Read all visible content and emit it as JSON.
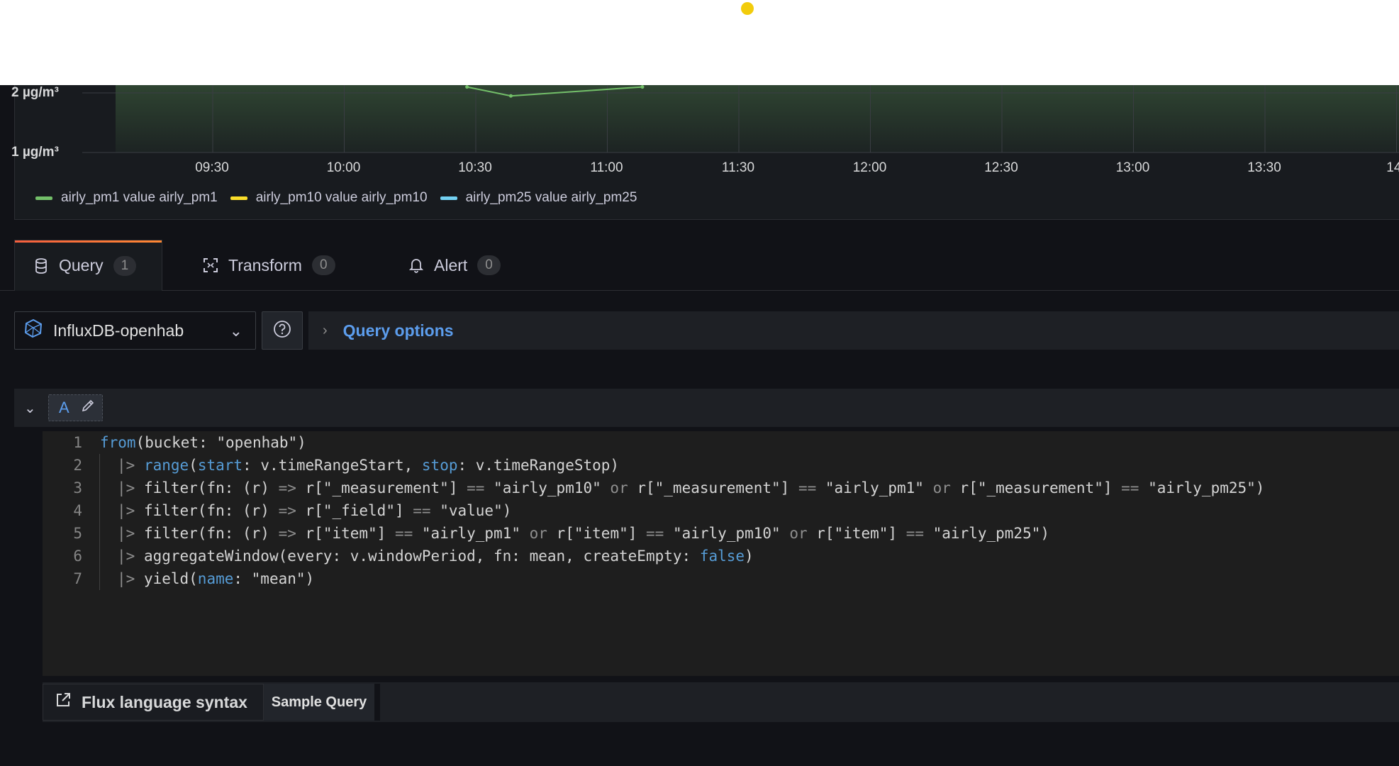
{
  "chart": {
    "y_ticks": [
      "2 µg/m³",
      "1 µg/m³"
    ],
    "x_ticks": [
      "09:30",
      "10:00",
      "10:30",
      "11:00",
      "11:30",
      "12:00",
      "12:30",
      "13:00",
      "13:30",
      "14:"
    ],
    "legend": [
      {
        "label": "airly_pm1 value airly_pm1",
        "color": "#73bf69"
      },
      {
        "label": "airly_pm10 value airly_pm10",
        "color": "#fade2a"
      },
      {
        "label": "airly_pm25 value airly_pm25",
        "color": "#5794f2"
      }
    ]
  },
  "chart_data": {
    "type": "line",
    "title": "",
    "xlabel": "",
    "ylabel": "",
    "categories": [
      "09:30",
      "10:00",
      "10:30",
      "11:00",
      "11:30",
      "12:00",
      "12:30",
      "13:00",
      "13:30",
      "14:"
    ],
    "series": [
      {
        "name": "airly_pm1 value airly_pm1",
        "x": [
          "10:28",
          "10:38",
          "11:08"
        ],
        "values": [
          2.1,
          1.95,
          2.1
        ]
      }
    ],
    "ylim": [
      1,
      2.1
    ],
    "grid": true,
    "legend_position": "bottom"
  },
  "tabs": [
    {
      "label": "Query",
      "count": "1",
      "icon": "database-icon"
    },
    {
      "label": "Transform",
      "count": "0",
      "icon": "transform-icon"
    },
    {
      "label": "Alert",
      "count": "0",
      "icon": "bell-icon"
    }
  ],
  "datasource": {
    "name": "InfluxDB-openhab"
  },
  "query_options_label": "Query options",
  "query": {
    "ref_id": "A"
  },
  "code_lines": [
    {
      "n": "1"
    },
    {
      "n": "2"
    },
    {
      "n": "3"
    },
    {
      "n": "4"
    },
    {
      "n": "5"
    },
    {
      "n": "6"
    },
    {
      "n": "7"
    }
  ],
  "code": {
    "l1": {
      "a": "from",
      "b": "(bucket: \"openhab\")"
    },
    "l2": {
      "pipe": "|> ",
      "a": "range",
      "b": "(",
      "c": "start",
      "d": ": v.timeRangeStart, ",
      "e": "stop",
      "f": ": v.timeRangeStop)"
    },
    "l3": {
      "pipe": "|> ",
      "a": "filter(fn: (r) ",
      "b": "=>",
      "c": " r[\"_measurement\"] ",
      "d": "==",
      "e": " \"airly_pm10\" ",
      "f": "or",
      "g": " r[\"_measurement\"] ",
      "h": "==",
      "i": " \"airly_pm1\" ",
      "j": "or",
      "k": " r[\"_measurement\"] ",
      "l": "==",
      "m": " \"airly_pm25\")"
    },
    "l4": {
      "pipe": "|> ",
      "a": "filter(fn: (r) ",
      "b": "=>",
      "c": " r[\"_field\"] ",
      "d": "==",
      "e": " \"value\")"
    },
    "l5": {
      "pipe": "|> ",
      "a": "filter(fn: (r) ",
      "b": "=>",
      "c": " r[\"item\"] ",
      "d": "==",
      "e": " \"airly_pm1\" ",
      "f": "or",
      "g": " r[\"item\"] ",
      "h": "==",
      "i": " \"airly_pm10\" ",
      "j": "or",
      "k": " r[\"item\"] ",
      "l": "==",
      "m": " \"airly_pm25\")"
    },
    "l6": {
      "pipe": "|> ",
      "a": "aggregateWindow(every: v.windowPeriod, fn: mean, createEmpty: ",
      "b": "false",
      "c": ")"
    },
    "l7": {
      "pipe": "|> ",
      "a": "yield(",
      "b": "name",
      "c": ": \"mean\")"
    }
  },
  "footer": {
    "flux_link": "Flux language syntax",
    "sample_query": "Sample Query"
  }
}
